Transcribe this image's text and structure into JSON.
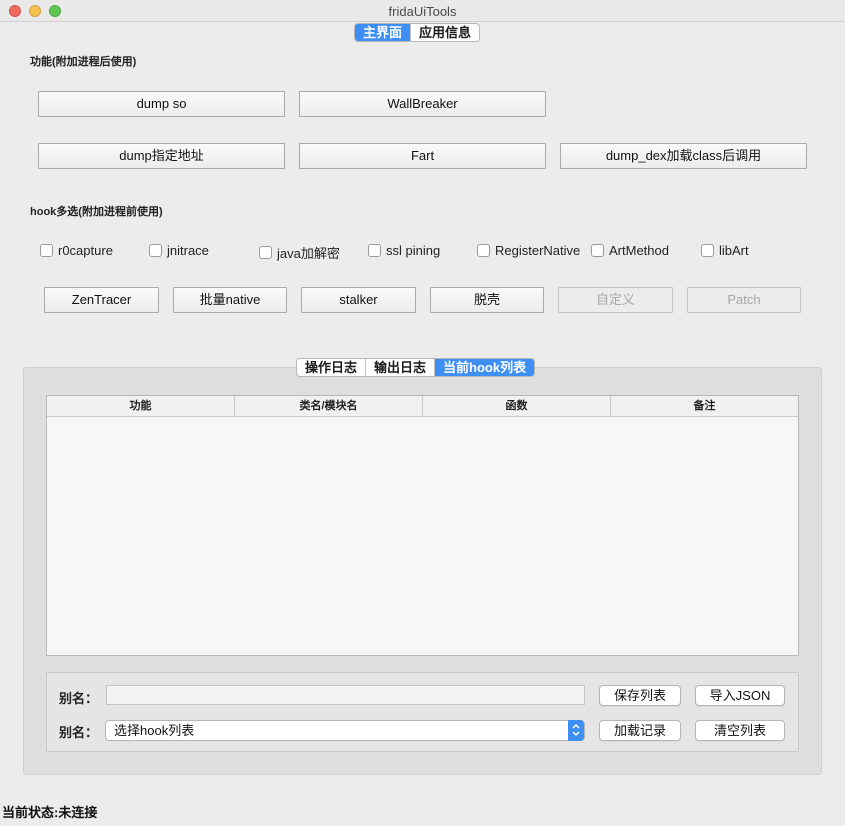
{
  "window": {
    "title": "fridaUiTools"
  },
  "main_tabs": {
    "main": "主界面",
    "app_info": "应用信息"
  },
  "functions": {
    "section_label": "功能(附加进程后使用)",
    "buttons": {
      "dump_so": "dump so",
      "wallbreaker": "WallBreaker",
      "dump_addr": "dump指定地址",
      "fart": "Fart",
      "dump_dex": "dump_dex加载class后调用"
    }
  },
  "hooks": {
    "section_label": "hook多选(附加进程前使用)",
    "checkboxes": {
      "r0capture": "r0capture",
      "jnitrace": "jnitrace",
      "java_crypto": "java加解密",
      "ssl_pinning": "ssl pining",
      "register_native": "RegisterNative",
      "art_method": "ArtMethod",
      "libart": "libArt"
    },
    "buttons": {
      "zentracer": "ZenTracer",
      "batch_native": "批量native",
      "stalker": "stalker",
      "unpack": "脱壳",
      "custom": "自定义",
      "patch": "Patch"
    }
  },
  "log_tabs": {
    "op_log": "操作日志",
    "output_log": "输出日志",
    "hook_list": "当前hook列表"
  },
  "table": {
    "columns": {
      "func": "功能",
      "class": "类名/模块名",
      "method": "函数",
      "note": "备注"
    },
    "rows": []
  },
  "bottom": {
    "alias1_label": "别名：",
    "alias1_value": "",
    "save_list": "保存列表",
    "import_json": "导入JSON",
    "alias2_label": "别名：",
    "select_value": "选择hook列表",
    "load_record": "加载记录",
    "clear_list": "清空列表"
  },
  "status": {
    "text": "当前状态:未连接"
  },
  "colors": {
    "accent": "#3d8ff5"
  }
}
